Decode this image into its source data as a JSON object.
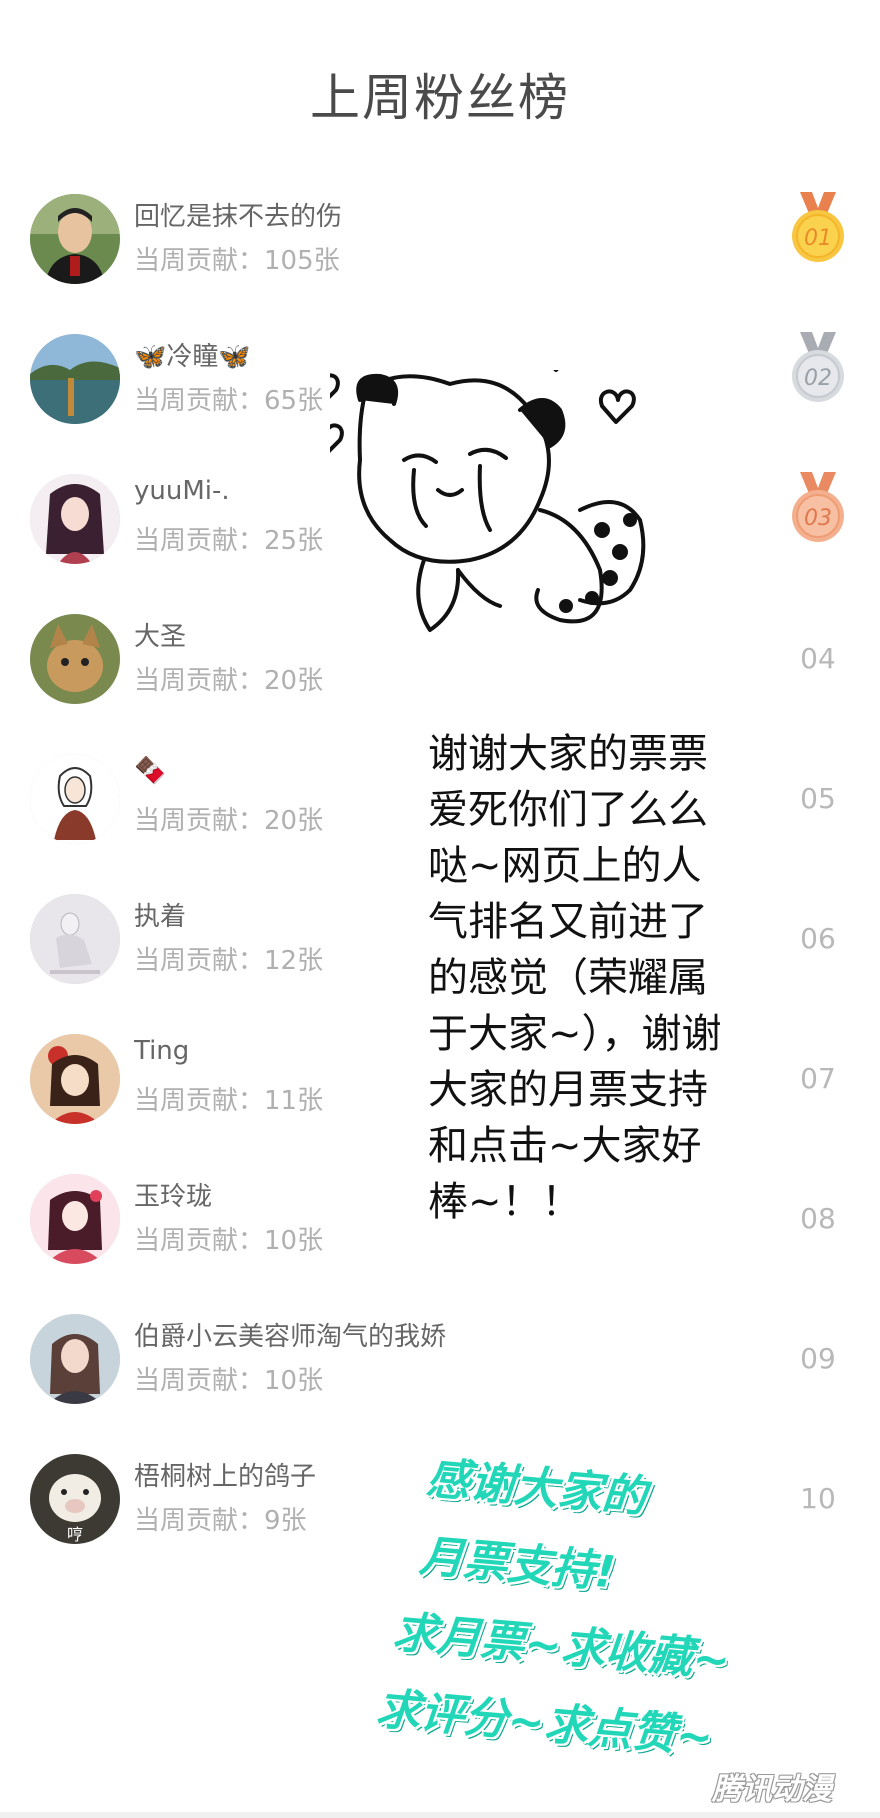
{
  "title": "上周粉丝榜",
  "contribution_label": "当周贡献：",
  "entries": [
    {
      "rank": "01",
      "name": "回忆是抹不去的伤",
      "tickets": "105张",
      "medal": "gold",
      "medal_color": "#f5a623",
      "avatar_icon": "user-photo-icon"
    },
    {
      "rank": "02",
      "name": "🦋冷瞳🦋",
      "tickets": "65张",
      "medal": "silver",
      "medal_color": "#b8bcc2",
      "avatar_icon": "lake-photo-icon"
    },
    {
      "rank": "03",
      "name": "yuuMi-.",
      "tickets": "25张",
      "medal": "bronze",
      "medal_color": "#f0a07a",
      "avatar_icon": "anime-girl-icon"
    },
    {
      "rank": "04",
      "name": "大圣",
      "tickets": "20张",
      "avatar_icon": "cat-photo-icon"
    },
    {
      "rank": "05",
      "name": "🍫",
      "tickets": "20张",
      "avatar_icon": "sketch-girl-icon"
    },
    {
      "rank": "06",
      "name": "执着",
      "tickets": "12张",
      "avatar_icon": "figure-photo-icon"
    },
    {
      "rank": "07",
      "name": "Ting",
      "tickets": "11张",
      "avatar_icon": "anime-girl-icon"
    },
    {
      "rank": "08",
      "name": "玉玲珑",
      "tickets": "10张",
      "avatar_icon": "anime-girl-icon"
    },
    {
      "rank": "09",
      "name": "伯爵小云美容师淘气的我娇",
      "tickets": "10张",
      "avatar_icon": "girl-photo-icon"
    },
    {
      "rank": "10",
      "name": "梧桐树上的鸽子",
      "tickets": "9张",
      "avatar_icon": "pig-photo-icon",
      "avatar_caption": "哼"
    }
  ],
  "thanks_text": "谢谢大家的票票爱死你们了么么哒~网页上的人气排名又前进了的感觉（荣耀属于大家~），谢谢大家的月票支持和点击~大家好棒~！！",
  "promo_lines": [
    "感谢大家的",
    "月票支持!",
    "求月票~求收藏~",
    "求评分~求点赞~"
  ],
  "watermark": "腾讯动漫",
  "colors": {
    "promo": "#22d6b8",
    "rank_text": "#b8b8b8",
    "contrib_text": "#b0b0b0"
  }
}
